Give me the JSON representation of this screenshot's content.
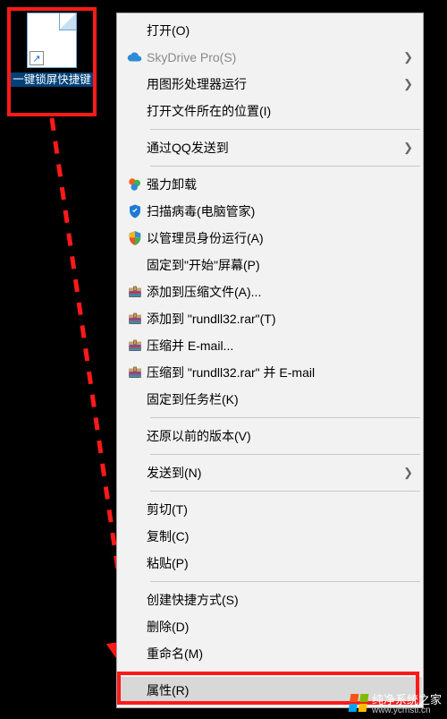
{
  "desktop_icon": {
    "label": "一键锁屏快捷键",
    "shortcut_arrow": "↗"
  },
  "menu": {
    "items": [
      {
        "label": "打开(O)",
        "icon": null,
        "submenu": false
      },
      {
        "label": "SkyDrive Pro(S)",
        "icon": "cloud",
        "submenu": true,
        "disabled": true
      },
      {
        "label": "用图形处理器运行",
        "icon": null,
        "submenu": true
      },
      {
        "label": "打开文件所在的位置(I)",
        "icon": null,
        "submenu": false
      },
      {
        "sep": true
      },
      {
        "label": "通过QQ发送到",
        "icon": null,
        "submenu": true
      },
      {
        "sep": true
      },
      {
        "label": "强力卸载",
        "icon": "uninstall",
        "submenu": false
      },
      {
        "label": "扫描病毒(电脑管家)",
        "icon": "shield",
        "submenu": false
      },
      {
        "label": "以管理员身份运行(A)",
        "icon": "uac",
        "submenu": false
      },
      {
        "label": "固定到\"开始\"屏幕(P)",
        "icon": null,
        "submenu": false
      },
      {
        "label": "添加到压缩文件(A)...",
        "icon": "rar",
        "submenu": false
      },
      {
        "label": "添加到 \"rundll32.rar\"(T)",
        "icon": "rar",
        "submenu": false
      },
      {
        "label": "压缩并 E-mail...",
        "icon": "rar",
        "submenu": false
      },
      {
        "label": "压缩到 \"rundll32.rar\" 并 E-mail",
        "icon": "rar",
        "submenu": false
      },
      {
        "label": "固定到任务栏(K)",
        "icon": null,
        "submenu": false
      },
      {
        "sep": true
      },
      {
        "label": "还原以前的版本(V)",
        "icon": null,
        "submenu": false
      },
      {
        "sep": true
      },
      {
        "label": "发送到(N)",
        "icon": null,
        "submenu": true
      },
      {
        "sep": true
      },
      {
        "label": "剪切(T)",
        "icon": null,
        "submenu": false
      },
      {
        "label": "复制(C)",
        "icon": null,
        "submenu": false
      },
      {
        "label": "粘贴(P)",
        "icon": null,
        "submenu": false
      },
      {
        "sep": true
      },
      {
        "label": "创建快捷方式(S)",
        "icon": null,
        "submenu": false
      },
      {
        "label": "删除(D)",
        "icon": null,
        "submenu": false
      },
      {
        "label": "重命名(M)",
        "icon": null,
        "submenu": false
      },
      {
        "sep": true
      },
      {
        "label": "属性(R)",
        "icon": null,
        "submenu": false,
        "highlight": true
      }
    ]
  },
  "watermark": {
    "text": "纯净系统之家",
    "url": "www.ycmsti.cn"
  }
}
